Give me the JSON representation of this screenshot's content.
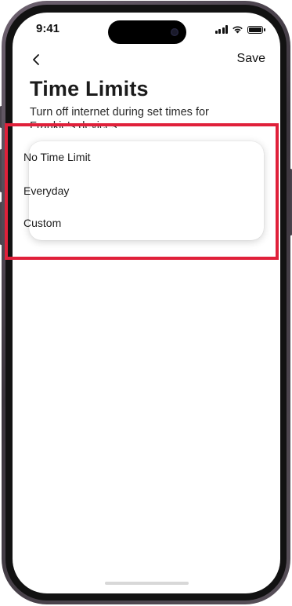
{
  "status_bar": {
    "time": "9:41"
  },
  "nav": {
    "back_icon": "chevron-left-icon",
    "save_label": "Save"
  },
  "page": {
    "title": "Time Limits",
    "subtitle_line1": "Turn off internet during set times for",
    "subtitle_line2": "Frankie's devices"
  },
  "dropdown": {
    "options": [
      {
        "label": "No Time Limit"
      },
      {
        "label": "Everyday"
      },
      {
        "label": "Custom"
      }
    ]
  },
  "colors": {
    "highlight": "#e0203a",
    "text": "#1b1b1b",
    "background": "#ffffff"
  }
}
